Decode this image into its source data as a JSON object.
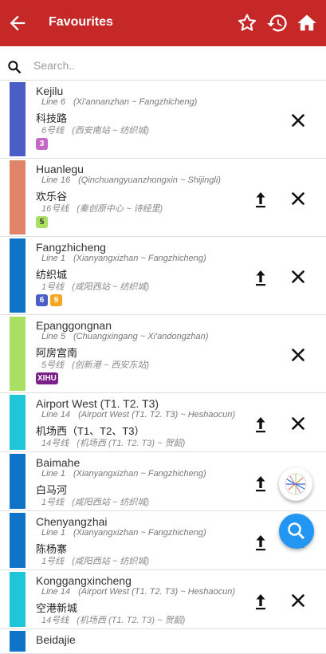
{
  "appbar": {
    "title": "Favourites",
    "icons": [
      "back-arrow-icon",
      "star-outline-icon",
      "history-icon",
      "home-icon"
    ]
  },
  "search": {
    "placeholder": "Search.."
  },
  "stations": [
    {
      "name": "Kejilu",
      "line": "Line 6",
      "route": "(Xi'annanzhan ~ Fangzhicheng)",
      "cn_name": "科技路",
      "cn_line": "6号线",
      "cn_route": "(西安南站 ~ 纺织城)",
      "color": "#4a5ec6",
      "badges": [
        {
          "text": "3",
          "color": "#c569c8"
        }
      ],
      "pin": false
    },
    {
      "name": "Huanlegu",
      "line": "Line 16",
      "route": "(Qinchuangyuanzhongxin ~ Shijingli)",
      "cn_name": "欢乐谷",
      "cn_line": "16号线",
      "cn_route": "(秦创原中心 ~ 诗经里)",
      "color": "#e0856a",
      "badges": [
        {
          "text": "5",
          "color": "#a9e063",
          "text_color": "#333333"
        }
      ],
      "pin": true
    },
    {
      "name": "Fangzhicheng",
      "line": "Line 1",
      "route": "(Xianyangxizhan ~ Fangzhicheng)",
      "cn_name": "纺织城",
      "cn_line": "1号线",
      "cn_route": "(咸阳西站 ~ 纺织城)",
      "color": "#0f74c8",
      "badges": [
        {
          "text": "6",
          "color": "#4a5ec6"
        },
        {
          "text": "9",
          "color": "#f5a623"
        }
      ],
      "pin": true
    },
    {
      "name": "Epanggongnan",
      "line": "Line 5",
      "route": "(Chuangxingang ~ Xi'andongzhan)",
      "cn_name": "阿房宫南",
      "cn_line": "5号线",
      "cn_route": "(创新港 ~ 西安东站)",
      "color": "#a9e063",
      "badges": [
        {
          "text": "XIHU",
          "color": "#7b1f8a"
        }
      ],
      "pin": false
    },
    {
      "name": "Airport West (T1. T2. T3)",
      "line": "Line 14",
      "route": "(Airport West (T1. T2. T3) ~ Heshaocun)",
      "cn_name": "机场西（T1、T2、T3）",
      "cn_line": "14号线",
      "cn_route": "(机场西 (T1. T2. T3) ~ 贺韶)",
      "color": "#1ec6d8",
      "badges": [],
      "pin": true
    },
    {
      "name": "Baimahe",
      "line": "Line 1",
      "route": "(Xianyangxizhan ~ Fangzhicheng)",
      "cn_name": "白马河",
      "cn_line": "1号线",
      "cn_route": "(咸阳西站 ~ 纺织城)",
      "color": "#0f74c8",
      "badges": [],
      "pin": true
    },
    {
      "name": "Chenyangzhai",
      "line": "Line 1",
      "route": "(Xianyangxizhan ~ Fangzhicheng)",
      "cn_name": "陈杨寨",
      "cn_line": "1号线",
      "cn_route": "(咸阳西站 ~ 纺织城)",
      "color": "#0f74c8",
      "badges": [],
      "pin": true
    },
    {
      "name": "Konggangxincheng",
      "line": "Line 14",
      "route": "(Airport West (T1. T2. T3) ~ Heshaocun)",
      "cn_name": "空港新城",
      "cn_line": "14号线",
      "cn_route": "(机场西 (T1. T2. T3) ~ 贺韶)",
      "color": "#1ec6d8",
      "badges": [],
      "pin": true
    },
    {
      "name": "Beidajie",
      "line": "",
      "route": "",
      "cn_name": "",
      "cn_line": "",
      "cn_route": "",
      "color": "#0f74c8",
      "badges": [],
      "pin": false
    }
  ],
  "fabs": {
    "map_icon": "metro-map-icon",
    "search_icon": "search-icon",
    "search_color": "#2196f3"
  }
}
